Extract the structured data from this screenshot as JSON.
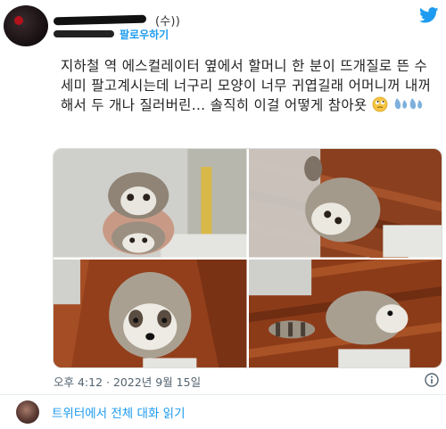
{
  "header": {
    "display_name_suffix": "(수))",
    "follow_label": "팔로우하기"
  },
  "tweet": {
    "text": "지하철 역 에스컬레이터 옆에서 할머니 한 분이 뜨개질로 뜬 수세미 팔고계시는데 너구리 모양이 너무 귀엽길래 어머니꺼 내꺼 해서 두 개나 질러버린... 솔직히 이걸 어떻게 참아욧",
    "emojis": [
      "face-with-rolling-eyes-icon",
      "sweat-droplets-icon"
    ]
  },
  "media": {
    "tiles": [
      {
        "name": "photo-raccoons-in-hand"
      },
      {
        "name": "photo-raccoon-on-wood"
      },
      {
        "name": "photo-raccoon-front"
      },
      {
        "name": "photo-raccoon-side"
      }
    ]
  },
  "meta": {
    "timestamp": "오후 4:12 · 2022년 9월 15일"
  },
  "footer": {
    "read_conversation": "트위터에서 전체 대화 읽기"
  },
  "colors": {
    "accent": "#1d9bf0",
    "text": "#0f1419",
    "muted": "#536471"
  }
}
